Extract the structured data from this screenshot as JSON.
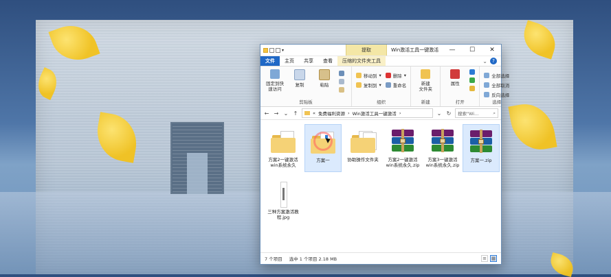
{
  "window": {
    "title": "Win激活工具一键激活",
    "context_tab_title": "提取",
    "buttons": {
      "minimize": "—",
      "maximize": "☐",
      "close": "✕"
    }
  },
  "tabs": [
    {
      "label": "文件"
    },
    {
      "label": "主页"
    },
    {
      "label": "共享"
    },
    {
      "label": "查看"
    },
    {
      "label": "压缩的文件夹工具"
    }
  ],
  "ribbon": {
    "clipboard": {
      "name": "剪贴板",
      "pin_label": "固定到快\n速访问",
      "copy_label": "复制",
      "paste_label": "粘贴"
    },
    "organize": {
      "name": "组织",
      "move_to": "移动到",
      "copy_to": "复制到",
      "delete": "删除",
      "rename": "重命名"
    },
    "new": {
      "name": "新建",
      "new_folder": "新建\n文件夹"
    },
    "open": {
      "name": "打开",
      "properties": "属性"
    },
    "select": {
      "name": "选择",
      "select_all": "全部选择",
      "select_none": "全部取消",
      "invert": "反向选择"
    }
  },
  "address": {
    "crumbs": [
      "免费福利资源",
      "Win激活工具一键激活"
    ],
    "search_placeholder": "搜索\"Wi..."
  },
  "files": [
    {
      "name": "方案2一键激活\nwin系统永久",
      "type": "folder-doc"
    },
    {
      "name": "方案一",
      "type": "folder-ring",
      "selected": true
    },
    {
      "name": "协助操作文件夹",
      "type": "folder-doc2"
    },
    {
      "name": "方案2一键激活\nwin系统永久.zip",
      "type": "zip"
    },
    {
      "name": "方案3一键激活\nwin系统永久.zip",
      "type": "zip"
    },
    {
      "name": "方案一.zip",
      "type": "zip",
      "selected": true
    },
    {
      "name": "三种方案激活教\n程.jpg",
      "type": "jpg"
    }
  ],
  "status": {
    "count": "7 个项目",
    "selected": "选中 1 个项目  2.18 MB"
  },
  "icons": {
    "folder_small": "folder-icon",
    "pin": "pin-icon",
    "copy": "copy-icon",
    "paste": "paste-icon",
    "cut": "scissors-icon",
    "move": "move-to-icon",
    "delete": "delete-icon",
    "rename": "rename-icon",
    "new_folder": "new-folder-icon",
    "properties": "properties-icon",
    "search": "search-icon",
    "back": "back-arrow-icon",
    "forward": "forward-arrow-icon",
    "up": "up-arrow-icon",
    "refresh": "refresh-icon",
    "details_view": "details-view-icon",
    "large_icons": "large-icons-view-icon"
  },
  "colors": {
    "accent_blue": "#1f68c6",
    "context_tab": "#f4e7a6",
    "selection": "#dbeafd"
  }
}
